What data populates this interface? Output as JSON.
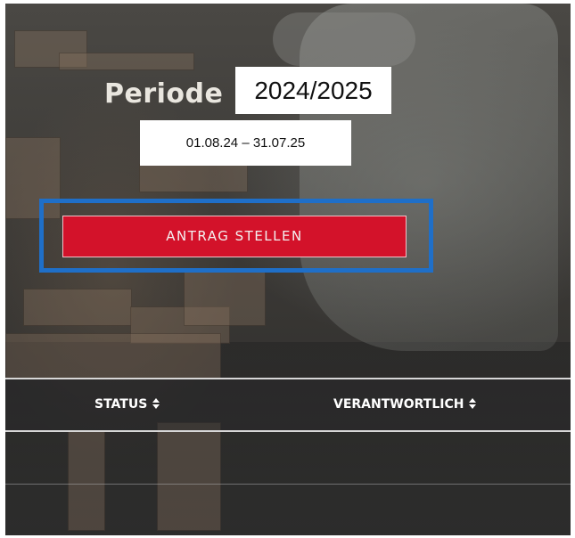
{
  "period": {
    "label": "Periode",
    "value": "2024/2025",
    "date_range": "01.08.24 – 31.07.25"
  },
  "actions": {
    "apply_button_label": "ANTRAG STELLEN",
    "highlight_color": "#1f6fc8",
    "button_color": "#d3122a"
  },
  "table": {
    "columns": [
      {
        "label": "STATUS",
        "sort_icon": "sort-updown-icon"
      },
      {
        "label": "VERANTWORTLICH",
        "sort_icon": "sort-updown-icon"
      }
    ]
  }
}
